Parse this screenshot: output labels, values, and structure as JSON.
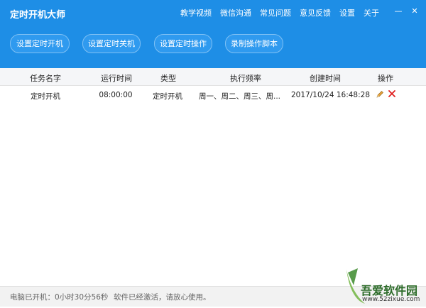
{
  "window": {
    "title": "定时开机大师",
    "menu": [
      "教学视频",
      "微信沟通",
      "常见问题",
      "意见反馈",
      "设置",
      "关于"
    ],
    "minimize_glyph": "—",
    "close_glyph": "✕"
  },
  "actions": {
    "set_poweron": "设置定时开机",
    "set_poweroff": "设置定时关机",
    "set_operation": "设置定时操作",
    "record_script": "录制操作脚本"
  },
  "table": {
    "headers": {
      "name": "任务名字",
      "run_time": "运行时间",
      "type": "类型",
      "frequency": "执行频率",
      "created": "创建时间",
      "ops": "操作"
    },
    "rows": [
      {
        "name": "定时开机",
        "run_time": "08:00:00",
        "type": "定时开机",
        "frequency": "周一、周二、周三、周...",
        "created": "2017/10/24 16:48:28"
      }
    ]
  },
  "status": {
    "uptime": "电脑已开机：0小时30分56秒",
    "activation": "软件已经激活，请放心使用。"
  },
  "watermark": {
    "name": "吾爱软件园",
    "site": "www.52zixue.com"
  },
  "colors": {
    "header_blue": "#1e8ee6",
    "button_blue": "#2f9aef",
    "delete_red": "#e02020"
  },
  "icons": {
    "edit": "pencil-icon",
    "delete": "delete-x-icon"
  }
}
